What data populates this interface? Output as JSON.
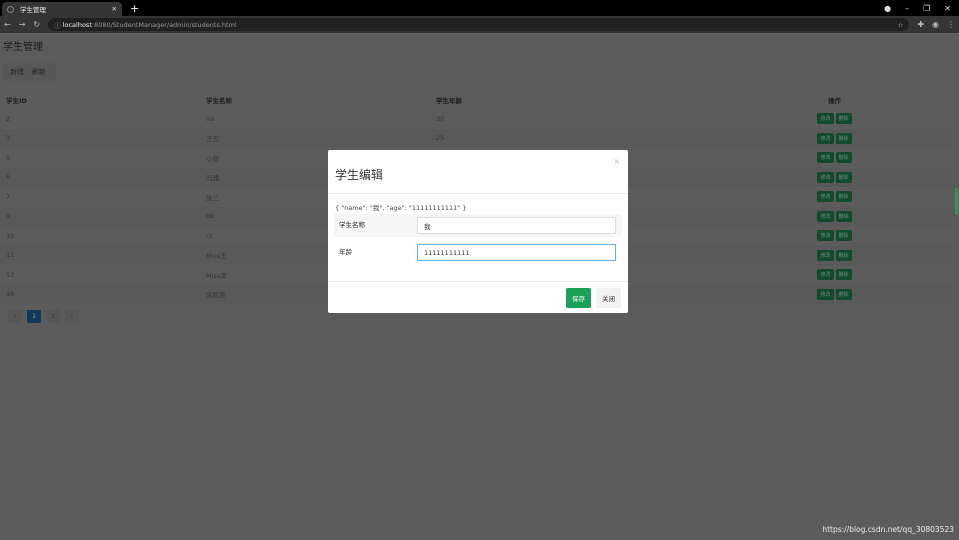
{
  "browser": {
    "tab_title": "学生管理",
    "url_host": "localhost",
    "url_path": ":8080/StudentManager/admin/students.html"
  },
  "page": {
    "title": "学生管理",
    "toolbar": {
      "new": "新建",
      "refresh": "刷新"
    }
  },
  "table": {
    "headers": [
      "学生ID",
      "学生名称",
      "学生年龄",
      "操作"
    ],
    "rows": [
      {
        "id": "2",
        "name": "lisi",
        "age": "30"
      },
      {
        "id": "3",
        "name": "王五",
        "age": "25"
      },
      {
        "id": "5",
        "name": "小张",
        "age": ""
      },
      {
        "id": "6",
        "name": "冯器",
        "age": ""
      },
      {
        "id": "7",
        "name": "张三",
        "age": ""
      },
      {
        "id": "9",
        "name": "bb",
        "age": ""
      },
      {
        "id": "10",
        "name": "cc",
        "age": ""
      },
      {
        "id": "11",
        "name": "Miss王",
        "age": ""
      },
      {
        "id": "12",
        "name": "Miss湾",
        "age": ""
      },
      {
        "id": "16",
        "name": "宋贾贾",
        "age": ""
      }
    ],
    "edit_label": "修改",
    "delete_label": "删除"
  },
  "pagination": {
    "prev": "‹",
    "pages": [
      "1",
      "2"
    ],
    "next": "›",
    "current": "1"
  },
  "modal": {
    "title": "学生编辑",
    "close": "×",
    "json_preview": "{ \"name\": \"我\", \"age\": \"11111111111\" }",
    "name_label": "学生名称",
    "name_value": "我",
    "age_label": "年龄",
    "age_value": "11111111111",
    "save": "保存",
    "cancel": "关闭"
  },
  "watermark": "https://blog.csdn.net/qq_30803523"
}
